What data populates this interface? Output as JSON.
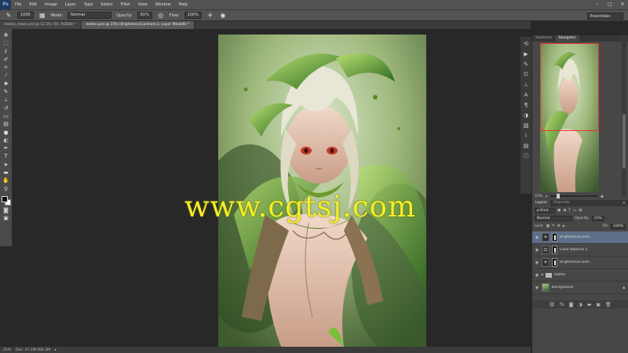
{
  "app": {
    "logo": "Ps"
  },
  "menubar": {
    "items": [
      "File",
      "Edit",
      "Image",
      "Layer",
      "Type",
      "Select",
      "Filter",
      "View",
      "Window",
      "Help"
    ],
    "controls": {
      "minimize": "–",
      "maximize": "□",
      "close": "✕"
    }
  },
  "options": {
    "brush_size": "1000",
    "mode_label": "Mode:",
    "mode_value": "Normal",
    "opacity_label": "Opacity:",
    "opacity_value": "91%",
    "flow_label": "Flow:",
    "flow_value": "100%",
    "workspace": "Essentials"
  },
  "doc_tabs": [
    {
      "label": "leafon_steps.psd @ 12.5% (30, RGB/8) *",
      "active": false
    },
    {
      "label": "leafon.psd @ 25% (Brightness/Contrast 2, Layer Mask/8) *",
      "active": true
    }
  ],
  "watermark": "www.cgtsj.com",
  "status": {
    "zoom": "25%",
    "doc": "Doc: 47.2M/306.3M"
  },
  "navigator": {
    "tabs": [
      "Swatches",
      "Navigator"
    ],
    "zoom": "25%"
  },
  "layers": {
    "tabs": [
      "Layers",
      "Channels"
    ],
    "filter": "ρ Kind",
    "blend": "Normal",
    "opacity_label": "Opacity:",
    "opacity": "72%",
    "lock_label": "Lock:",
    "fill_label": "Fill:",
    "fill": "100%",
    "items": [
      {
        "name": "Brightness/Contr...",
        "kind": "adjust",
        "selected": true
      },
      {
        "name": "Color Balance 1",
        "kind": "balance",
        "selected": false
      },
      {
        "name": "Brightness/Contr...",
        "kind": "adjust",
        "selected": false
      },
      {
        "name": "leafon",
        "kind": "folder",
        "selected": false
      },
      {
        "name": "Background",
        "kind": "background",
        "selected": false
      }
    ]
  },
  "colors": {
    "accent": "#5c6f86",
    "watermark": "#f2ee2a"
  }
}
